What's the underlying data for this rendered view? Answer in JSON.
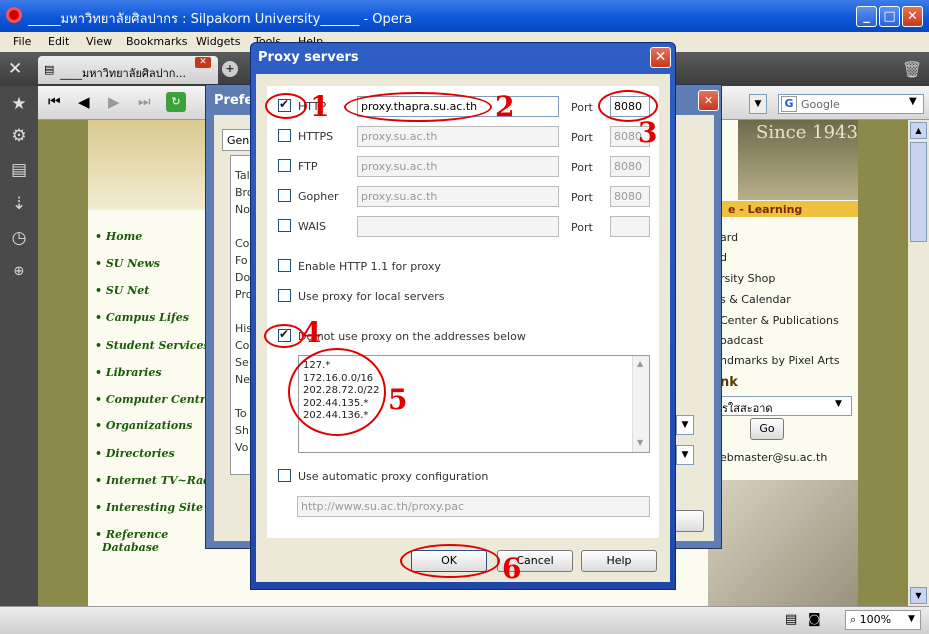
{
  "window": {
    "title": "_____มหาวิทยาลัยศิลปากร : Silpakorn University______ - Opera",
    "min": "_",
    "max": "□",
    "close": "✕"
  },
  "menu": [
    "File",
    "Edit",
    "View",
    "Bookmarks",
    "Widgets",
    "Tools",
    "Help"
  ],
  "tab": {
    "label": "____มหาวิทยาลัยศิลปาก..."
  },
  "search": {
    "placeholder": "Google"
  },
  "nav_links": [
    "• Home",
    "• SU News",
    "• SU Net",
    "• Campus Lifes",
    "• Student Services",
    "• Libraries",
    "• Computer Centre",
    "• Organizations",
    "• Directories",
    "• Internet TV~Radio",
    "• Interesting Site",
    "• Reference",
    "Database"
  ],
  "right_links": [
    "e - Learning",
    "ard",
    "d",
    "rsity Shop",
    "s & Calendar",
    "Center & Publications",
    "oadcast",
    "ndmarks by Pixel Arts",
    "nk",
    "รใสสะอาด",
    "Go",
    "ebmaster@su.ac.th",
    "Since 1943"
  ],
  "prefs": {
    "title": "Prefe",
    "tab": "Gen",
    "items": [
      "Tal",
      "Bro",
      "No",
      "Co",
      "Fo",
      "Do",
      "Pro",
      "His",
      "Co",
      "Se",
      "Ne",
      "To",
      "Sh",
      "Vo"
    ]
  },
  "proxy": {
    "title": "Proxy servers",
    "close": "✕",
    "port_label": "Port",
    "rows": [
      {
        "label": "HTTP",
        "checked": true,
        "host": "proxy.thapra.su.ac.th",
        "port": "8080",
        "active": true
      },
      {
        "label": "HTTPS",
        "checked": false,
        "host": "proxy.su.ac.th",
        "port": "8080",
        "active": false
      },
      {
        "label": "FTP",
        "checked": false,
        "host": "proxy.su.ac.th",
        "port": "8080",
        "active": false
      },
      {
        "label": "Gopher",
        "checked": false,
        "host": "proxy.su.ac.th",
        "port": "8080",
        "active": false
      },
      {
        "label": "WAIS",
        "checked": false,
        "host": "",
        "port": "",
        "active": false
      }
    ],
    "http11": "Enable HTTP 1.1 for proxy",
    "local": "Use proxy for local servers",
    "dont_use": "Do not use proxy on the addresses below",
    "addresses": [
      "127.*",
      "172.16.0.0/16",
      "202.28.72.0/22",
      "202.44.135.*",
      "202.44.136.*"
    ],
    "auto": "Use automatic proxy configuration",
    "auto_url": "http://www.su.ac.th/proxy.pac",
    "ok": "OK",
    "cancel": "Cancel",
    "help": "Help"
  },
  "annotations": [
    "1",
    "2",
    "3",
    "4",
    "5",
    "6"
  ],
  "status": {
    "zoom": "100%"
  },
  "colors": {
    "annotation": "#e00000",
    "titlebar": "#0a55d8"
  }
}
